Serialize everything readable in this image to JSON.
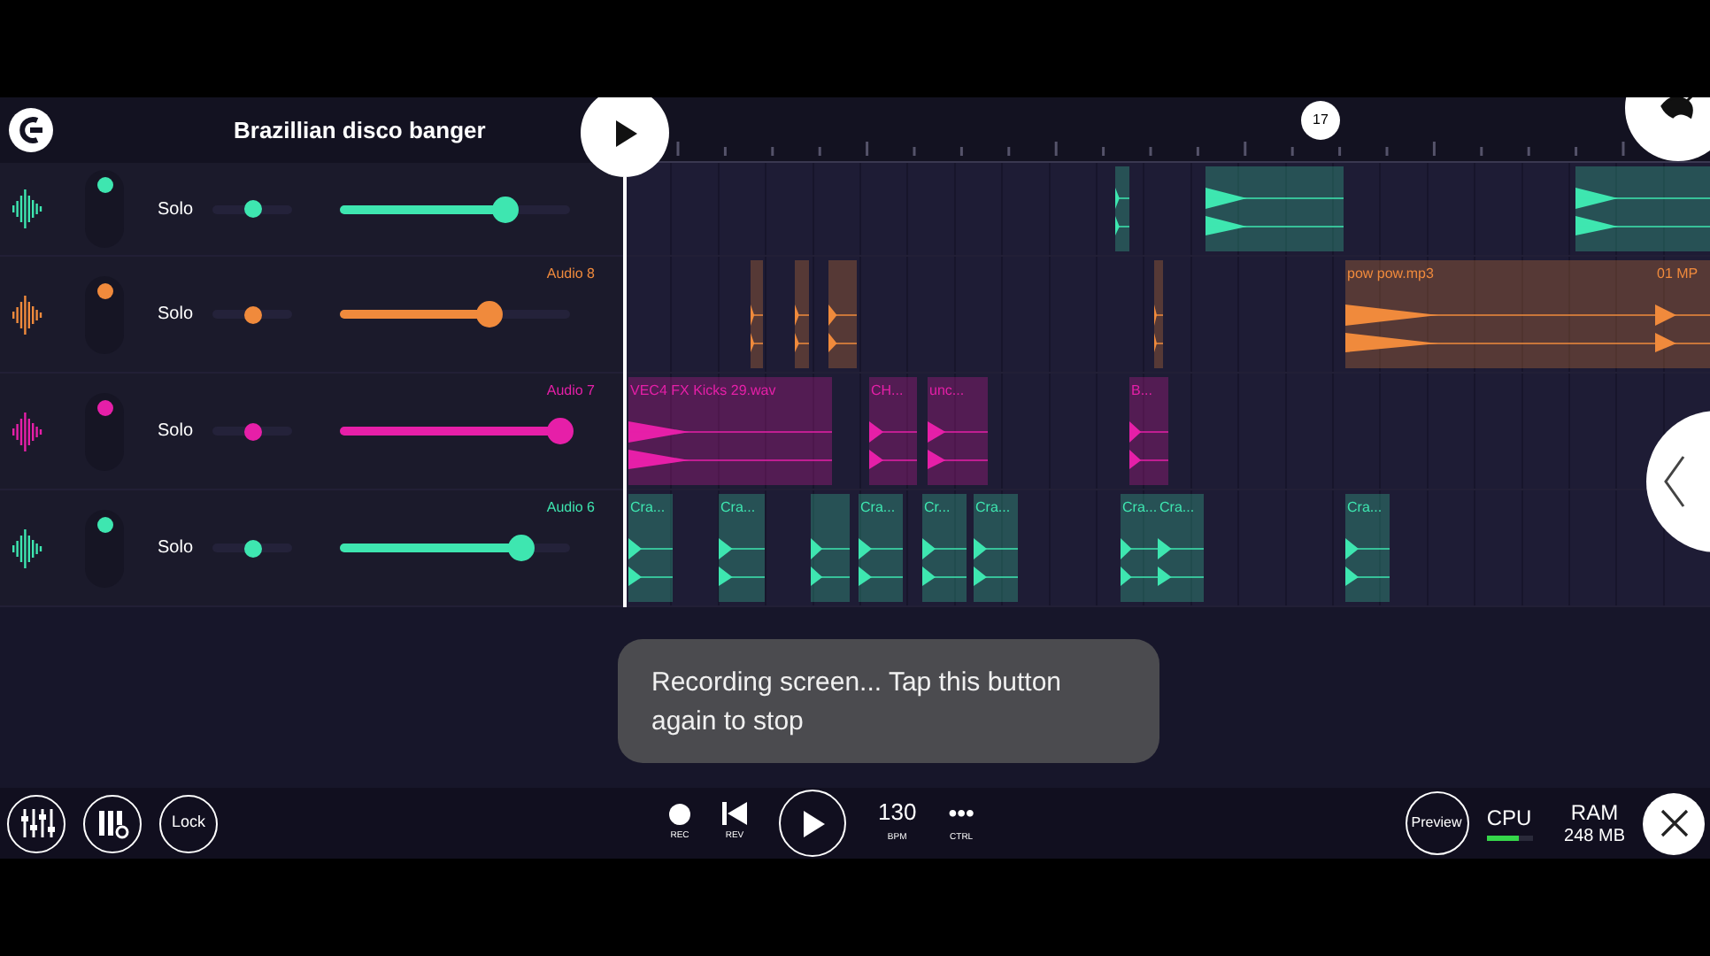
{
  "project": {
    "title": "Brazillian disco banger"
  },
  "timeline": {
    "marker": "17"
  },
  "tracks": [
    {
      "color": "#3ee6b0",
      "solo": "Solo",
      "pan": {
        "level": 0.5
      },
      "volume": {
        "level": 0.72
      }
    },
    {
      "name": "Audio 8",
      "color": "#f08a3c",
      "solo": "Solo",
      "pan": {
        "level": 0.5
      },
      "volume": {
        "level": 0.65
      },
      "clips": [
        {
          "label": "pow pow.mp3"
        },
        {
          "label": "01 MP"
        }
      ]
    },
    {
      "name": "Audio 7",
      "color": "#e61fa8",
      "solo": "Solo",
      "pan": {
        "level": 0.5
      },
      "volume": {
        "level": 0.96
      },
      "clips": [
        {
          "label": "VEC4 FX Kicks 29.wav"
        },
        {
          "label": "CH..."
        },
        {
          "label": "unc..."
        },
        {
          "label": "B..."
        }
      ]
    },
    {
      "name": "Audio 6",
      "color": "#3ee6b0",
      "solo": "Solo",
      "pan": {
        "level": 0.5
      },
      "volume": {
        "level": 0.79
      },
      "clips": [
        {
          "label": "Cra..."
        },
        {
          "label": "Cra..."
        },
        {
          "label": "Cra..."
        },
        {
          "label": "Cr..."
        },
        {
          "label": "Cra..."
        },
        {
          "label": "Cra..."
        },
        {
          "label": "Cra..."
        },
        {
          "label": "Cra..."
        }
      ]
    }
  ],
  "toast": {
    "text": "Recording screen... Tap this button again to stop"
  },
  "bottom_bar": {
    "lock": "Lock",
    "rec": "REC",
    "rev": "REV",
    "tempo": {
      "value": "130",
      "caption": "BPM"
    },
    "ctrl": {
      "symbol": "•••",
      "caption": "CTRL"
    },
    "preview": "Preview",
    "cpu": {
      "label": "CPU",
      "level": 0.7
    },
    "ram": {
      "label": "RAM",
      "value": "248 MB"
    }
  }
}
